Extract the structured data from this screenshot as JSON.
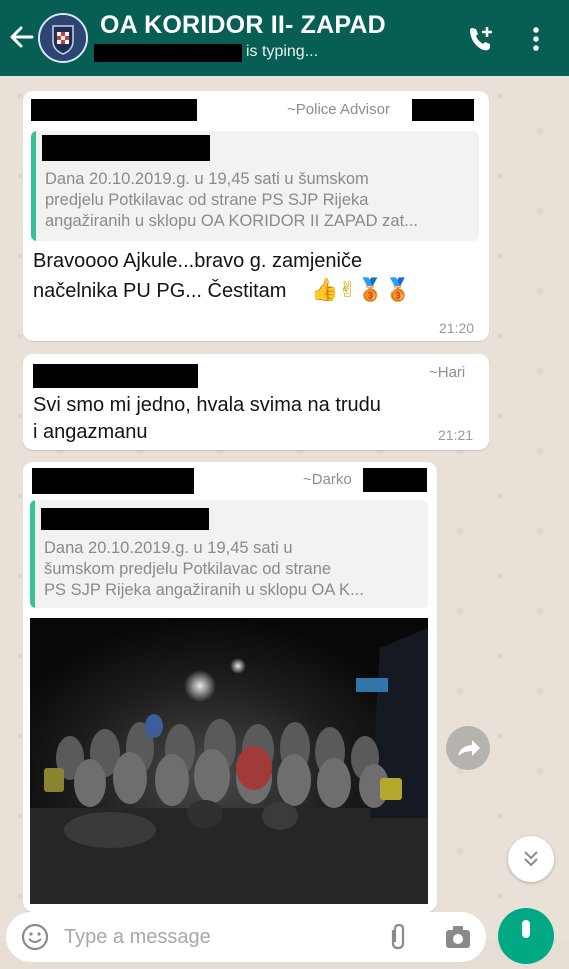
{
  "header": {
    "title": "OA KORIDOR II- ZAPAD",
    "status": "is typing..."
  },
  "messages": [
    {
      "alias": "~Police Advisor",
      "quote": [
        "Dana 20.10.2019.g. u 19,45 sati u šumskom",
        "predjelu Potkilavac od strane PS SJP Rijeka",
        "angažiranih u sklopu OA KORIDOR II ZAPAD zat..."
      ],
      "text": [
        "Bravoooo Ajkule...bravo g. zamjeniče",
        "načelnika PU PG... Čestitam"
      ],
      "emoji": "👍✌🥉🥉",
      "time": "21:20"
    },
    {
      "alias": "~Hari",
      "text": [
        "Svi smo mi jedno, hvala svima na trudu",
        "i angazmanu"
      ],
      "time": "21:21"
    },
    {
      "alias": "~Darko",
      "quote": [
        "Dana 20.10.2019.g. u 19,45 sati u",
        "šumskom predjelu Potkilavac od strane",
        "PS SJP Rijeka angažiranih u sklopu OA K..."
      ]
    }
  ],
  "composer": {
    "placeholder": "Type a message"
  },
  "colors": {
    "header": "#075e54",
    "quote_bar": "#35c49a",
    "fab": "#00a884"
  }
}
